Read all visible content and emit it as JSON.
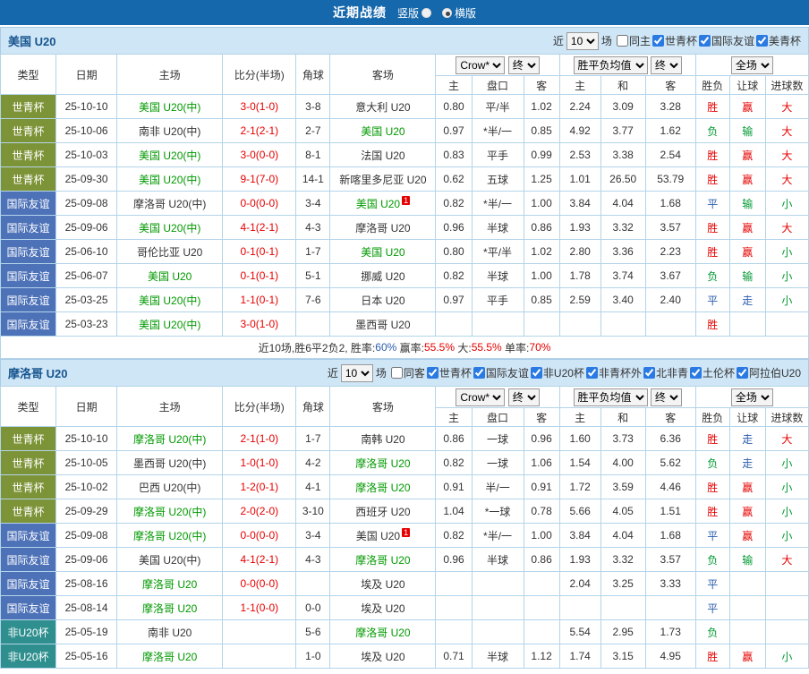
{
  "topbar": {
    "title": "近期战绩",
    "layout_options": [
      {
        "label": "竖版",
        "selected": false
      },
      {
        "label": "横版",
        "selected": true
      }
    ]
  },
  "table_header": {
    "type": "类型",
    "date": "日期",
    "home": "主场",
    "score": "比分(半场)",
    "corner": "角球",
    "away": "客场",
    "odds_source_select": "Crow*",
    "final_select_1": "终",
    "avg_select": "胜平负均值",
    "final_select_2": "终",
    "scope_select": "全场",
    "sub": {
      "o_home": "主",
      "o_handicap": "盘口",
      "o_away": "客",
      "e_home": "主",
      "e_draw": "和",
      "e_away": "客",
      "wdl": "胜负",
      "handicap": "让球",
      "goals": "进球数"
    }
  },
  "type_colors": {
    "世青杯": "#7d9337",
    "国际友谊": "#4e72b8",
    "非U20杯": "#2f8f8f"
  },
  "result_colors": {
    "胜": "#e60000",
    "负": "#009933",
    "平": "#2b5cad",
    "赢": "#e60000",
    "输": "#009933",
    "走": "#2b5cad",
    "大": "#e60000",
    "小": "#009933"
  },
  "team_highlight_color": "#009900",
  "team_default_color": "#333333",
  "score_color": "#e60000",
  "sections": [
    {
      "title": "美国 U20",
      "filters": {
        "near": "近",
        "count": "10",
        "games": "场",
        "checkboxes": [
          {
            "label": "同主",
            "checked": false
          },
          {
            "label": "世青杯",
            "checked": true
          },
          {
            "label": "国际友谊",
            "checked": true
          },
          {
            "label": "美青杯",
            "checked": true
          }
        ]
      },
      "rows": [
        {
          "type": "世青杯",
          "date": "25-10-10",
          "home": "美国 U20(中)",
          "hl": "home",
          "score": "3-0(1-0)",
          "corner": "3-8",
          "away": "意大利 U20",
          "away_badge": "",
          "odds": [
            "0.80",
            "平/半",
            "1.02"
          ],
          "europe": [
            "2.24",
            "3.09",
            "3.28"
          ],
          "wdl": "胜",
          "let": "赢",
          "ou": "大"
        },
        {
          "type": "世青杯",
          "date": "25-10-06",
          "home": "南非 U20(中)",
          "hl": "away",
          "score": "2-1(2-1)",
          "corner": "2-7",
          "away": "美国 U20",
          "away_badge": "",
          "odds": [
            "0.97",
            "*半/一",
            "0.85"
          ],
          "europe": [
            "4.92",
            "3.77",
            "1.62"
          ],
          "wdl": "负",
          "let": "输",
          "ou": "大"
        },
        {
          "type": "世青杯",
          "date": "25-10-03",
          "home": "美国 U20(中)",
          "hl": "home",
          "score": "3-0(0-0)",
          "corner": "8-1",
          "away": "法国 U20",
          "away_badge": "",
          "odds": [
            "0.83",
            "平手",
            "0.99"
          ],
          "europe": [
            "2.53",
            "3.38",
            "2.54"
          ],
          "wdl": "胜",
          "let": "赢",
          "ou": "大"
        },
        {
          "type": "世青杯",
          "date": "25-09-30",
          "home": "美国 U20(中)",
          "hl": "home",
          "score": "9-1(7-0)",
          "corner": "14-1",
          "away": "新喀里多尼亚 U20",
          "away_badge": "",
          "odds": [
            "0.62",
            "五球",
            "1.25"
          ],
          "europe": [
            "1.01",
            "26.50",
            "53.79"
          ],
          "wdl": "胜",
          "let": "赢",
          "ou": "大"
        },
        {
          "type": "国际友谊",
          "date": "25-09-08",
          "home": "摩洛哥 U20(中)",
          "hl": "away",
          "score": "0-0(0-0)",
          "corner": "3-4",
          "away": "美国 U20",
          "away_badge": "1",
          "odds": [
            "0.82",
            "*半/一",
            "1.00"
          ],
          "europe": [
            "3.84",
            "4.04",
            "1.68"
          ],
          "wdl": "平",
          "let": "输",
          "ou": "小"
        },
        {
          "type": "国际友谊",
          "date": "25-09-06",
          "home": "美国 U20(中)",
          "hl": "home",
          "score": "4-1(2-1)",
          "corner": "4-3",
          "away": "摩洛哥 U20",
          "away_badge": "",
          "odds": [
            "0.96",
            "半球",
            "0.86"
          ],
          "europe": [
            "1.93",
            "3.32",
            "3.57"
          ],
          "wdl": "胜",
          "let": "赢",
          "ou": "大"
        },
        {
          "type": "国际友谊",
          "date": "25-06-10",
          "home": "哥伦比亚 U20",
          "hl": "away",
          "score": "0-1(0-1)",
          "corner": "1-7",
          "away": "美国 U20",
          "away_badge": "",
          "odds": [
            "0.80",
            "*平/半",
            "1.02"
          ],
          "europe": [
            "2.80",
            "3.36",
            "2.23"
          ],
          "wdl": "胜",
          "let": "赢",
          "ou": "小"
        },
        {
          "type": "国际友谊",
          "date": "25-06-07",
          "home": "美国 U20",
          "hl": "home",
          "score": "0-1(0-1)",
          "corner": "5-1",
          "away": "挪威 U20",
          "away_badge": "",
          "odds": [
            "0.82",
            "半球",
            "1.00"
          ],
          "europe": [
            "1.78",
            "3.74",
            "3.67"
          ],
          "wdl": "负",
          "let": "输",
          "ou": "小"
        },
        {
          "type": "国际友谊",
          "date": "25-03-25",
          "home": "美国 U20(中)",
          "hl": "home",
          "score": "1-1(0-1)",
          "corner": "7-6",
          "away": "日本 U20",
          "away_badge": "",
          "odds": [
            "0.97",
            "平手",
            "0.85"
          ],
          "europe": [
            "2.59",
            "3.40",
            "2.40"
          ],
          "wdl": "平",
          "let": "走",
          "ou": "小"
        },
        {
          "type": "国际友谊",
          "date": "25-03-23",
          "home": "美国 U20(中)",
          "hl": "home",
          "score": "3-0(1-0)",
          "corner": "",
          "away": "墨西哥 U20",
          "away_badge": "",
          "odds": [
            "",
            "",
            ""
          ],
          "europe": [
            "",
            "",
            ""
          ],
          "wdl": "胜",
          "let": "",
          "ou": ""
        }
      ],
      "footer_segments": [
        {
          "text": "近10场,胜6平2负2, 胜率:",
          "color": "#333333"
        },
        {
          "text": "60%",
          "color": "#2b5cad"
        },
        {
          "text": " 赢率:",
          "color": "#333333"
        },
        {
          "text": "55.5%",
          "color": "#e60000"
        },
        {
          "text": " 大:",
          "color": "#333333"
        },
        {
          "text": "55.5%",
          "color": "#e60000"
        },
        {
          "text": " 单率:",
          "color": "#333333"
        },
        {
          "text": "70%",
          "color": "#e60000"
        }
      ]
    },
    {
      "title": "摩洛哥 U20",
      "filters": {
        "near": "近",
        "count": "10",
        "games": "场",
        "checkboxes": [
          {
            "label": "同客",
            "checked": false
          },
          {
            "label": "世青杯",
            "checked": true
          },
          {
            "label": "国际友谊",
            "checked": true
          },
          {
            "label": "非U20杯",
            "checked": true
          },
          {
            "label": "非青杯外",
            "checked": true
          },
          {
            "label": "北非青",
            "checked": true
          },
          {
            "label": "土伦杯",
            "checked": true
          },
          {
            "label": "阿拉伯U20",
            "checked": true
          }
        ]
      },
      "rows": [
        {
          "type": "世青杯",
          "date": "25-10-10",
          "home": "摩洛哥 U20(中)",
          "hl": "home",
          "score": "2-1(1-0)",
          "corner": "1-7",
          "away": "南韩 U20",
          "away_badge": "",
          "odds": [
            "0.86",
            "一球",
            "0.96"
          ],
          "europe": [
            "1.60",
            "3.73",
            "6.36"
          ],
          "wdl": "胜",
          "let": "走",
          "ou": "大"
        },
        {
          "type": "世青杯",
          "date": "25-10-05",
          "home": "墨西哥 U20(中)",
          "hl": "away",
          "score": "1-0(1-0)",
          "corner": "4-2",
          "away": "摩洛哥 U20",
          "away_badge": "",
          "odds": [
            "0.82",
            "一球",
            "1.06"
          ],
          "europe": [
            "1.54",
            "4.00",
            "5.62"
          ],
          "wdl": "负",
          "let": "走",
          "ou": "小"
        },
        {
          "type": "世青杯",
          "date": "25-10-02",
          "home": "巴西 U20(中)",
          "hl": "away",
          "score": "1-2(0-1)",
          "corner": "4-1",
          "away": "摩洛哥 U20",
          "away_badge": "",
          "odds": [
            "0.91",
            "半/一",
            "0.91"
          ],
          "europe": [
            "1.72",
            "3.59",
            "4.46"
          ],
          "wdl": "胜",
          "let": "赢",
          "ou": "小"
        },
        {
          "type": "世青杯",
          "date": "25-09-29",
          "home": "摩洛哥 U20(中)",
          "hl": "home",
          "score": "2-0(2-0)",
          "corner": "3-10",
          "away": "西班牙 U20",
          "away_badge": "",
          "odds": [
            "1.04",
            "*一球",
            "0.78"
          ],
          "europe": [
            "5.66",
            "4.05",
            "1.51"
          ],
          "wdl": "胜",
          "let": "赢",
          "ou": "小"
        },
        {
          "type": "国际友谊",
          "date": "25-09-08",
          "home": "摩洛哥 U20(中)",
          "hl": "home",
          "score": "0-0(0-0)",
          "corner": "3-4",
          "away": "美国 U20",
          "away_badge": "1",
          "odds": [
            "0.82",
            "*半/一",
            "1.00"
          ],
          "europe": [
            "3.84",
            "4.04",
            "1.68"
          ],
          "wdl": "平",
          "let": "赢",
          "ou": "小"
        },
        {
          "type": "国际友谊",
          "date": "25-09-06",
          "home": "美国 U20(中)",
          "hl": "away",
          "score": "4-1(2-1)",
          "corner": "4-3",
          "away": "摩洛哥 U20",
          "away_badge": "",
          "odds": [
            "0.96",
            "半球",
            "0.86"
          ],
          "europe": [
            "1.93",
            "3.32",
            "3.57"
          ],
          "wdl": "负",
          "let": "输",
          "ou": "大"
        },
        {
          "type": "国际友谊",
          "date": "25-08-16",
          "home": "摩洛哥 U20",
          "hl": "home",
          "score": "0-0(0-0)",
          "corner": "",
          "away": "埃及 U20",
          "away_badge": "",
          "odds": [
            "",
            "",
            ""
          ],
          "europe": [
            "2.04",
            "3.25",
            "3.33"
          ],
          "wdl": "平",
          "let": "",
          "ou": ""
        },
        {
          "type": "国际友谊",
          "date": "25-08-14",
          "home": "摩洛哥 U20",
          "hl": "home",
          "score": "1-1(0-0)",
          "corner": "0-0",
          "away": "埃及 U20",
          "away_badge": "",
          "odds": [
            "",
            "",
            ""
          ],
          "europe": [
            "",
            "",
            ""
          ],
          "wdl": "平",
          "let": "",
          "ou": ""
        },
        {
          "type": "非U20杯",
          "date": "25-05-19",
          "home": "南非 U20",
          "hl": "away",
          "score": "",
          "corner": "5-6",
          "away": "摩洛哥 U20",
          "away_badge": "",
          "odds": [
            "",
            "",
            ""
          ],
          "europe": [
            "5.54",
            "2.95",
            "1.73"
          ],
          "wdl": "负",
          "let": "",
          "ou": ""
        },
        {
          "type": "非U20杯",
          "date": "25-05-16",
          "home": "摩洛哥 U20",
          "hl": "home",
          "score": "",
          "corner": "1-0",
          "away": "埃及 U20",
          "away_badge": "",
          "odds": [
            "0.71",
            "半球",
            "1.12"
          ],
          "europe": [
            "1.74",
            "3.15",
            "4.95"
          ],
          "wdl": "胜",
          "let": "赢",
          "ou": "小"
        }
      ],
      "footer_segments": []
    }
  ]
}
